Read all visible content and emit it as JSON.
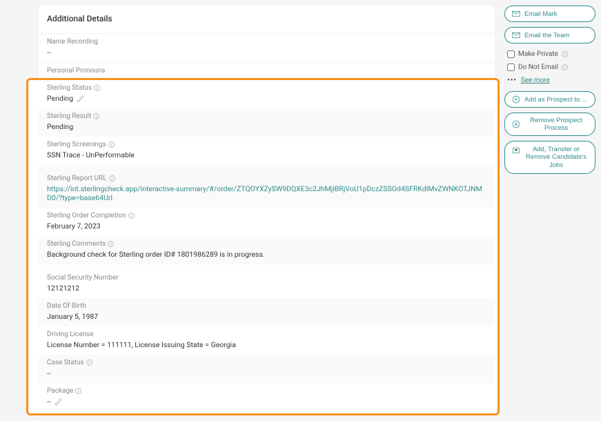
{
  "card": {
    "title": "Additional Details"
  },
  "fields": {
    "nameRecording": {
      "label": "Name Recording",
      "value": "--"
    },
    "personalPronouns": {
      "label": "Personal Pronouns"
    },
    "sterlingStatus": {
      "label": "Sterling Status",
      "value": "Pending"
    },
    "sterlingResult": {
      "label": "Sterling Result",
      "value": "Pending"
    },
    "sterlingScreenings": {
      "label": "Sterling Screenings",
      "value": "SSN Trace - UnPerformable"
    },
    "sterlingReportUrl": {
      "label": "Sterling Report URL",
      "value": "https://int.sterlingcheck.app/interactive-summary/#/order/ZTQOYXZySW9DQXE3c2JhMjlBRjVoU1pDczZSSOd4SFRKdlMvZWNKOTJNMD0/?type=base64Url"
    },
    "sterlingOrderCompletion": {
      "label": "Sterling Order Completion",
      "value": "February 7, 2023"
    },
    "sterlingComments": {
      "label": "Sterling Comments",
      "value": "Background check for Sterling order ID# 1801986289 is in progress."
    },
    "ssn": {
      "label": "Social Security Number",
      "value": "12121212"
    },
    "dob": {
      "label": "Date Of Birth",
      "value": "January 5, 1987"
    },
    "drivingLicense": {
      "label": "Driving License",
      "value": "License Number = 111111, License Issuing State = Georgia"
    },
    "caseStatus": {
      "label": "Case Status",
      "value": "--"
    },
    "package": {
      "label": "Package",
      "value": "--"
    }
  },
  "side": {
    "emailMark": "Email Mark",
    "emailTeam": "Email the Team",
    "makePrivate": "Make Private",
    "doNotEmail": "Do Not Email",
    "seeMore": "See more",
    "addProspect": "Add as Prospect to ...",
    "removeProspect": "Remove Prospect Process",
    "addTransfer": "Add, Transfer or Remove Candidate's Jobs"
  }
}
